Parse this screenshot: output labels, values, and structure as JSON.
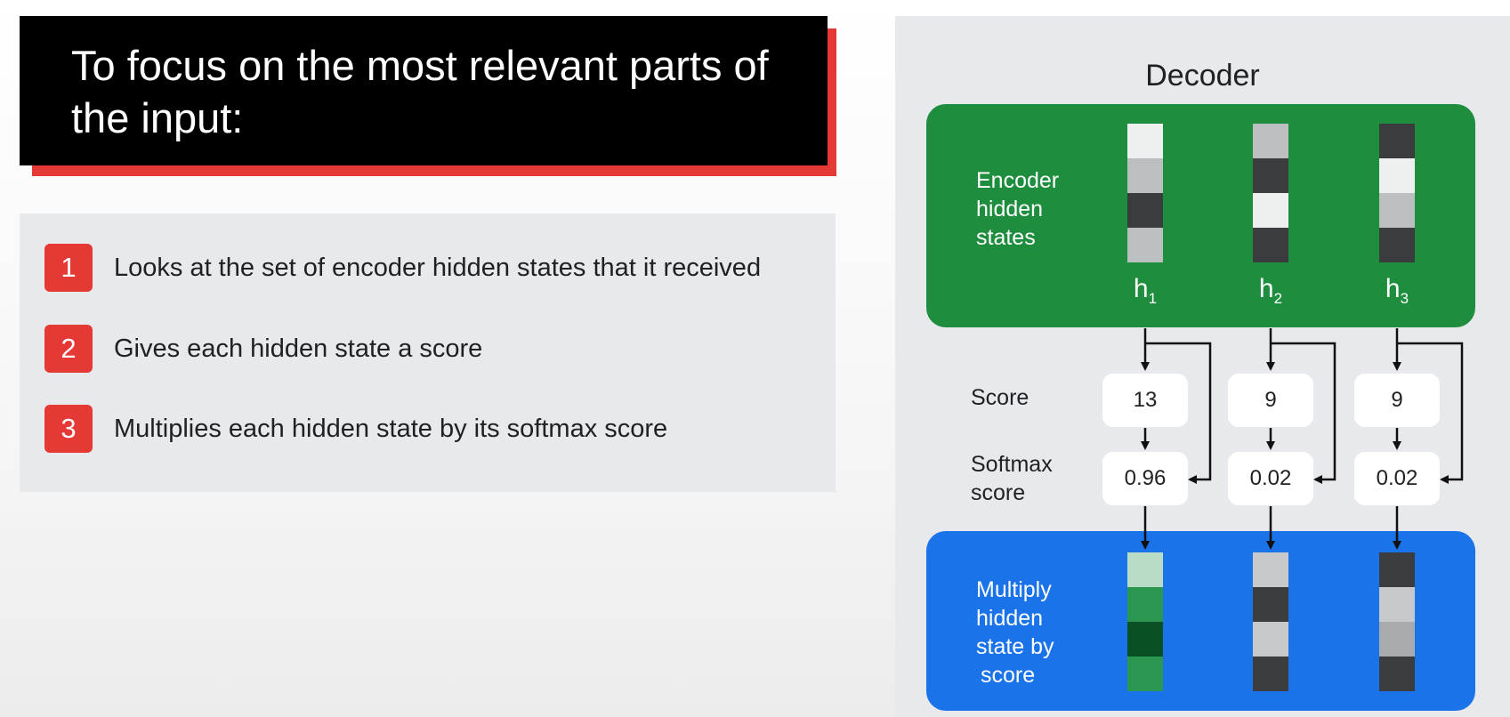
{
  "title": {
    "text": "To focus on the most relevant parts of the input:"
  },
  "steps": [
    {
      "number": "1",
      "text": "Looks at the set of encoder hidden states that it received"
    },
    {
      "number": "2",
      "text": "Gives each hidden state a score"
    },
    {
      "number": "3",
      "text": "Multiplies each hidden state by its softmax score"
    }
  ],
  "diagram": {
    "title": "Decoder",
    "encoder_label": [
      "Encoder",
      "hidden",
      "states"
    ],
    "score_label": "Score",
    "softmax_label": [
      "Softmax",
      "score"
    ],
    "multiply_label": [
      "Multiply",
      "hidden",
      "state by",
      "score"
    ],
    "hidden_states": [
      {
        "name": "h",
        "index": "1",
        "colors": [
          "#eef0f0",
          "#bcbfc2",
          "#3b3c3e",
          "#bcbfc2"
        ]
      },
      {
        "name": "h",
        "index": "2",
        "colors": [
          "#bcbfc2",
          "#3b3c3e",
          "#eef0f0",
          "#3b3c3e"
        ]
      },
      {
        "name": "h",
        "index": "3",
        "colors": [
          "#3b3c3e",
          "#eef0f0",
          "#bcbfc2",
          "#3b3c3e"
        ]
      }
    ],
    "scores": [
      "13",
      "9",
      "9"
    ],
    "softmax_scores": [
      "0.96",
      "0.02",
      "0.02"
    ],
    "weighted_states": [
      {
        "colors": [
          "#b9dcc7",
          "#2a9650",
          "#0b4f24",
          "#2a9650"
        ]
      },
      {
        "colors": [
          "#c6c8cb",
          "#3b3c3e",
          "#c6c8cb",
          "#3b3c3e"
        ]
      },
      {
        "colors": [
          "#3b3c3e",
          "#c6c8cb",
          "#a8abae",
          "#3b3c3e"
        ]
      }
    ],
    "colors": {
      "encoder_box": "#1e8e3e",
      "multiply_box": "#1a73e8",
      "badge": "#e53935",
      "title_card": "#000000"
    }
  }
}
